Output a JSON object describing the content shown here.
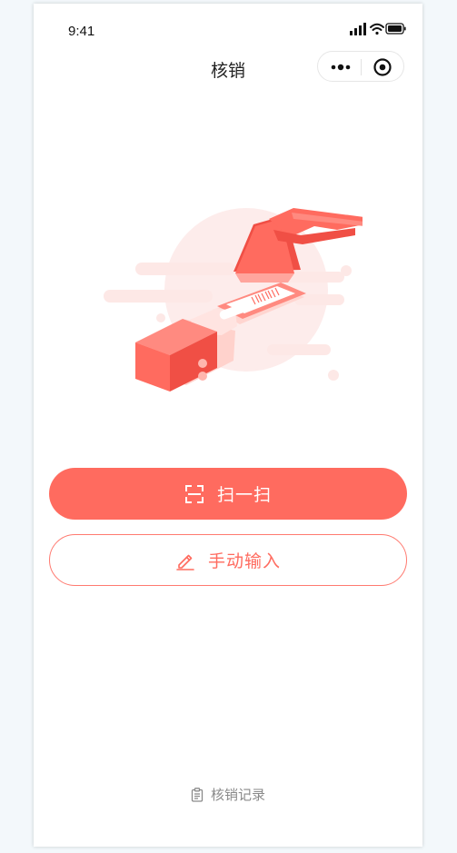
{
  "status_bar": {
    "time": "9:41"
  },
  "nav": {
    "title": "核销"
  },
  "actions": {
    "scan_label": "扫一扫",
    "manual_label": "手动输入"
  },
  "footer": {
    "records_label": "核销记录"
  },
  "icons": {
    "scan": "scan-frame-icon",
    "manual": "pencil-icon",
    "records": "clipboard-icon",
    "more": "more-dots-icon",
    "close": "target-circle-icon"
  },
  "colors": {
    "accent": "#ff6b5f",
    "illustration_light": "#fde8e6",
    "text_muted": "#8a8a8a"
  }
}
